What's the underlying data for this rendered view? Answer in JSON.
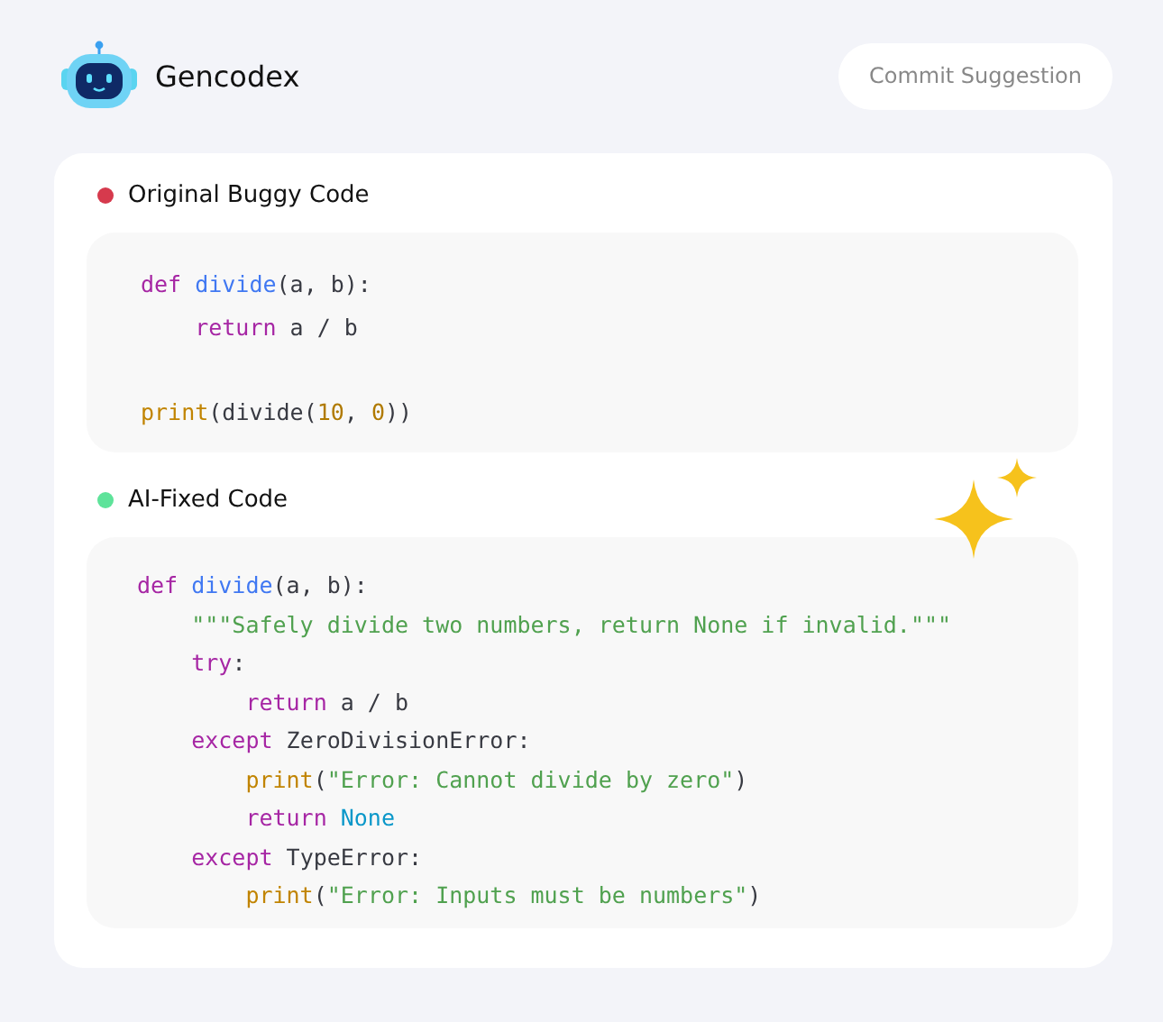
{
  "app": {
    "name": "Gencodex"
  },
  "commit_button": {
    "label": "Commit Suggestion"
  },
  "sections": [
    {
      "title": "Original Buggy Code",
      "color": "#d63a4d",
      "sparkles": false,
      "lines": [
        {
          "kind": "code",
          "tokens": [
            {
              "text": "def ",
              "kind": "keyword"
            },
            {
              "text": "divide",
              "kind": "function"
            },
            {
              "text": "(a, b):",
              "kind": "plain"
            }
          ]
        },
        {
          "kind": "code",
          "tokens": [
            {
              "text": "    return",
              "kind": "keyword"
            },
            {
              "text": " a / b",
              "kind": "plain"
            }
          ]
        },
        {
          "kind": "blank"
        },
        {
          "kind": "code",
          "tokens": [
            {
              "text": "print",
              "kind": "builtin"
            },
            {
              "text": "(divide(",
              "kind": "plain"
            },
            {
              "text": "10",
              "kind": "number"
            },
            {
              "text": ", ",
              "kind": "plain"
            },
            {
              "text": "0",
              "kind": "number"
            },
            {
              "text": "))",
              "kind": "plain"
            }
          ]
        }
      ]
    },
    {
      "title": "AI-Fixed Code",
      "color": "#5ee39a",
      "sparkles": true,
      "lines": [
        {
          "kind": "code",
          "tokens": [
            {
              "text": "def ",
              "kind": "keyword"
            },
            {
              "text": "divide",
              "kind": "function"
            },
            {
              "text": "(a, b):",
              "kind": "plain"
            }
          ]
        },
        {
          "kind": "code",
          "tokens": [
            {
              "text": "    \"\"\"Safely divide two numbers, return None if invalid.\"\"\"",
              "kind": "string"
            }
          ]
        },
        {
          "kind": "code",
          "tokens": [
            {
              "text": "    try",
              "kind": "keyword"
            },
            {
              "text": ":",
              "kind": "plain"
            }
          ]
        },
        {
          "kind": "code",
          "tokens": [
            {
              "text": "        return",
              "kind": "keyword"
            },
            {
              "text": " a / b",
              "kind": "plain"
            }
          ]
        },
        {
          "kind": "code",
          "tokens": [
            {
              "text": "    except",
              "kind": "keyword"
            },
            {
              "text": " ZeroDivisionError:",
              "kind": "plain"
            }
          ]
        },
        {
          "kind": "code",
          "tokens": [
            {
              "text": "        print",
              "kind": "builtin"
            },
            {
              "text": "(",
              "kind": "plain"
            },
            {
              "text": "\"Error: Cannot divide by zero\"",
              "kind": "string"
            },
            {
              "text": ")",
              "kind": "plain"
            }
          ]
        },
        {
          "kind": "code",
          "tokens": [
            {
              "text": "        return",
              "kind": "keyword"
            },
            {
              "text": " None",
              "kind": "constant"
            }
          ]
        },
        {
          "kind": "code",
          "tokens": [
            {
              "text": "    except",
              "kind": "keyword"
            },
            {
              "text": " TypeError:",
              "kind": "plain"
            }
          ]
        },
        {
          "kind": "code",
          "tokens": [
            {
              "text": "        print",
              "kind": "builtin"
            },
            {
              "text": "(",
              "kind": "plain"
            },
            {
              "text": "\"Error: Inputs must be numbers\"",
              "kind": "string"
            },
            {
              "text": ")",
              "kind": "plain"
            }
          ]
        }
      ]
    }
  ]
}
